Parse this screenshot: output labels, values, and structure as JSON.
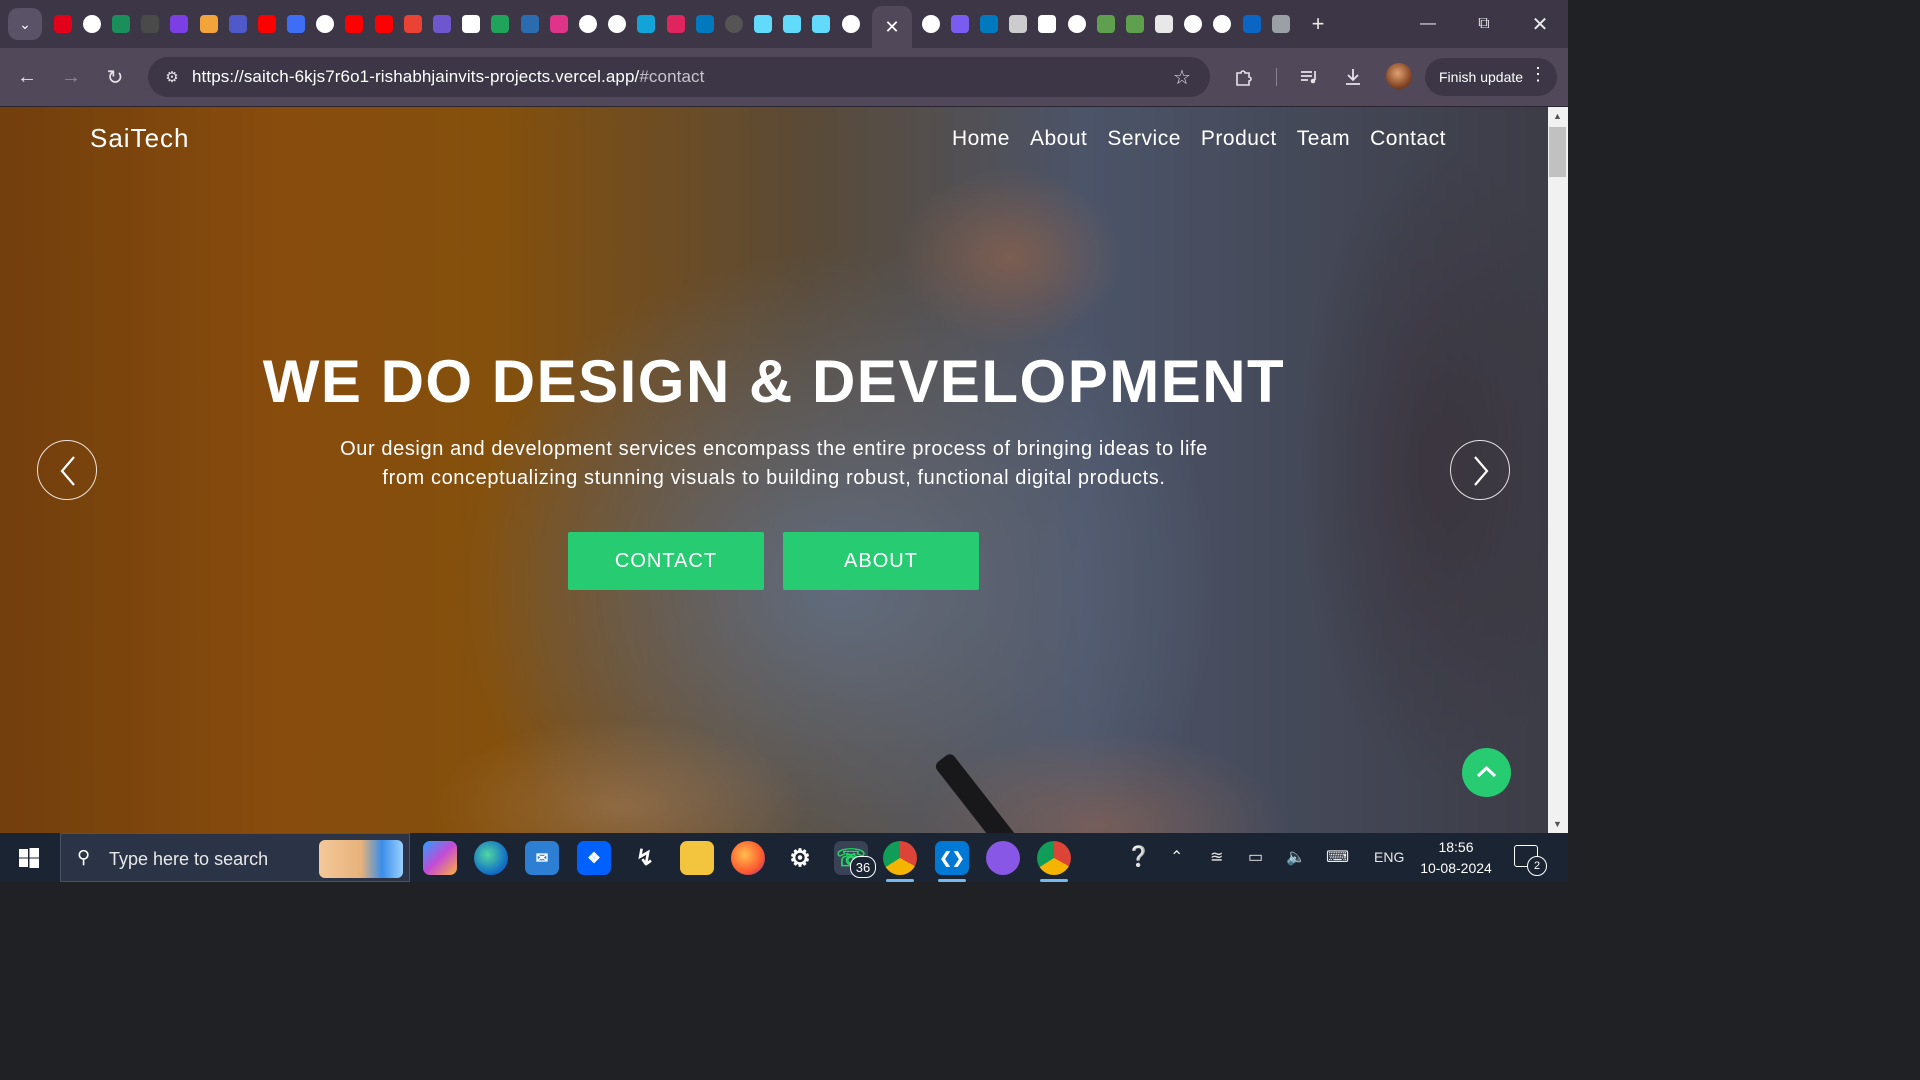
{
  "browser": {
    "pinned_tabs": [
      {
        "icon": "opera-icon",
        "color": "#e3001b"
      },
      {
        "icon": "github-icon",
        "color": "#ffffff"
      },
      {
        "icon": "sheets-icon",
        "color": "#1a8f5c"
      },
      {
        "icon": "server-icon",
        "color": "#4a4a4a"
      },
      {
        "icon": "prompt-icon",
        "color": "#7b3fe4"
      },
      {
        "icon": "dev-icon",
        "color": "#f2a33a"
      },
      {
        "icon": "teams-icon",
        "color": "#5059c9"
      },
      {
        "icon": "youtube-icon",
        "color": "#ff0000"
      },
      {
        "icon": "k-icon",
        "color": "#3d6ef5"
      },
      {
        "icon": "github-icon",
        "color": "#ffffff"
      },
      {
        "icon": "youtube-icon",
        "color": "#ff0000"
      },
      {
        "icon": "youtube-icon",
        "color": "#ff0000"
      },
      {
        "icon": "gmail-icon",
        "color": "#ea4335"
      },
      {
        "icon": "list-icon",
        "color": "#6e56cf"
      },
      {
        "icon": "a-icon",
        "color": "#ffffff"
      },
      {
        "icon": "plus-app-icon",
        "color": "#20a35b"
      },
      {
        "icon": "devcom-icon",
        "color": "#2b6cb0"
      },
      {
        "icon": "pink-app-icon",
        "color": "#e0338a"
      },
      {
        "icon": "google-icon",
        "color": "#ffffff"
      },
      {
        "icon": "google-icon",
        "color": "#ffffff"
      },
      {
        "icon": "notion-n-icon",
        "color": "#12a4d9"
      },
      {
        "icon": "heart-icon",
        "color": "#e0245e"
      },
      {
        "icon": "trello-icon",
        "color": "#0079bf"
      },
      {
        "icon": "github-icon",
        "color": "#555555"
      },
      {
        "icon": "react-icon",
        "color": "#61dafb"
      },
      {
        "icon": "react-icon",
        "color": "#61dafb"
      },
      {
        "icon": "react-icon",
        "color": "#61dafb"
      },
      {
        "icon": "github-icon",
        "color": "#ffffff"
      }
    ],
    "active_tab_close": "✕",
    "pinned_tabs_right": [
      {
        "icon": "google-icon",
        "color": "#ffffff"
      },
      {
        "icon": "cloud-icon",
        "color": "#7b5cf0"
      },
      {
        "icon": "trello-icon",
        "color": "#0079bf"
      },
      {
        "icon": "page-icon",
        "color": "#cccccc"
      },
      {
        "icon": "vercel-icon",
        "color": "#ffffff"
      },
      {
        "icon": "openai-icon",
        "color": "#ffffff"
      },
      {
        "icon": "node-icon",
        "color": "#5fa04e"
      },
      {
        "icon": "node-icon",
        "color": "#5fa04e"
      },
      {
        "icon": "speaker-icon",
        "color": "#e8e8e8"
      },
      {
        "icon": "openai-icon",
        "color": "#ffffff"
      },
      {
        "icon": "google-icon",
        "color": "#ffffff"
      },
      {
        "icon": "linkedin-icon",
        "color": "#0a66c2"
      },
      {
        "icon": "globe-icon",
        "color": "#9aa0a6"
      }
    ],
    "new_tab": "+",
    "url_host": "https://saitch-6kjs7r6o1-rishabhjainvits-projects.vercel.app/",
    "url_rest": "#contact",
    "update_label": "Finish update"
  },
  "site": {
    "logo": "SaiTech",
    "nav": [
      "Home",
      "About",
      "Service",
      "Product",
      "Team",
      "Contact"
    ],
    "hero_title": "WE DO DESIGN & DEVELOPMENT",
    "hero_line1": "Our design and development services encompass the entire process of bringing ideas to life",
    "hero_line2": "from conceptualizing stunning visuals to building robust, functional digital products.",
    "btn_contact": "CONTACT",
    "btn_about": "ABOUT",
    "accent": "#27cc72"
  },
  "taskbar": {
    "search_placeholder": "Type here to search",
    "whatsapp_badge": "36",
    "language": "ENG",
    "time": "18:56",
    "date": "10-08-2024",
    "notifications": "2"
  }
}
